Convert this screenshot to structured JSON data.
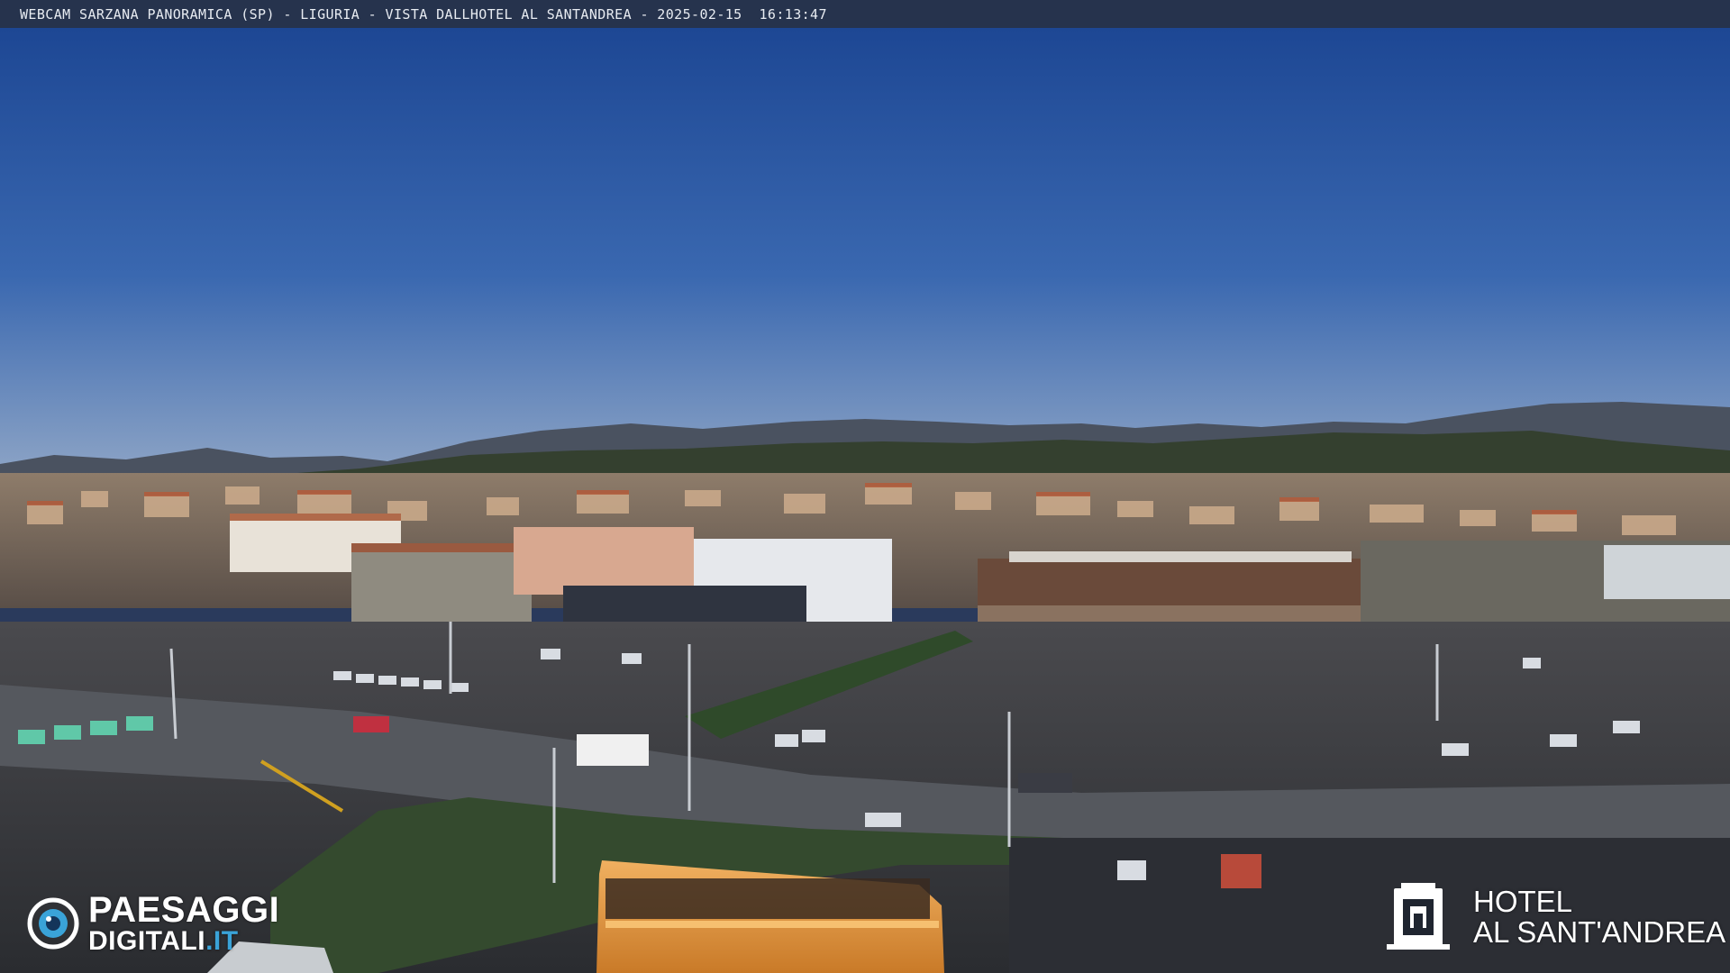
{
  "banner": {
    "caption": "WEBCAM SARZANA PANORAMICA (SP) - LIGURIA - VISTA DALLHOTEL AL SANTANDREA - 2025-02-15  16:13:47"
  },
  "watermark_left": {
    "line1": "PAESAGGI",
    "line2": "DIGITALI",
    "line2_suffix": ".IT",
    "icon": "eye-icon",
    "accent_color": "#3aa3d8"
  },
  "watermark_right": {
    "line1": "HOTEL",
    "line2": "AL SANT'ANDREA",
    "icon": "building-crest-icon"
  },
  "colors": {
    "sky_top": "#1e4a96",
    "sky_bottom": "#8aa2c4",
    "hills": "#3b4535",
    "road": "#4a4e56",
    "bus": "#e89a3c"
  }
}
